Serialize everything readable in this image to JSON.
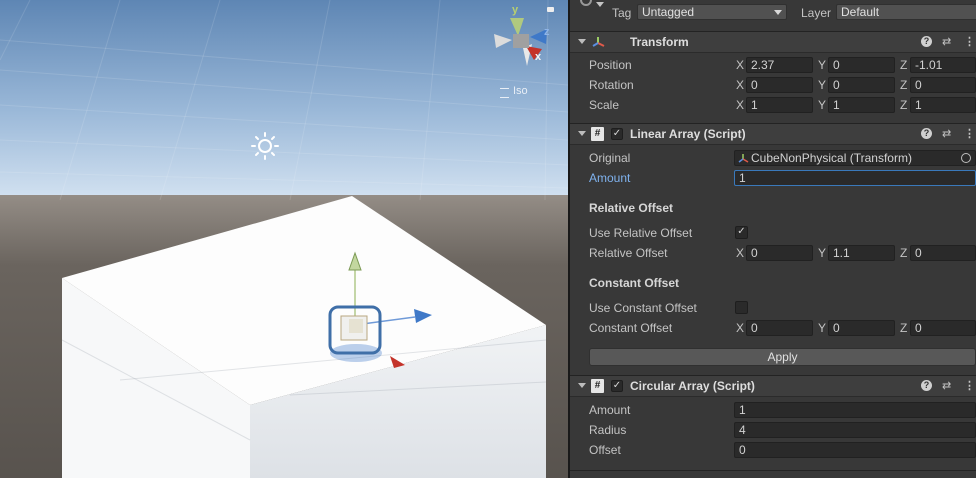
{
  "scene": {
    "iso_label": "Iso",
    "gizmo_axes": {
      "x": "x",
      "y": "y",
      "z": "z"
    },
    "colors": {
      "sky_top": "#5e86b4",
      "sky_horizon": "#d3e2f1",
      "ground": "#5d5853",
      "x_axis": "#c4332a",
      "y_axis": "#b1c88a",
      "z_axis": "#3f79c8"
    }
  },
  "inspector": {
    "tag_label": "Tag",
    "tag_value": "Untagged",
    "layer_label": "Layer",
    "layer_value": "Default",
    "transform": {
      "title": "Transform",
      "position": {
        "label": "Position",
        "x": "2.37",
        "y": "0",
        "z": "-1.01"
      },
      "rotation": {
        "label": "Rotation",
        "x": "0",
        "y": "0",
        "z": "0"
      },
      "scale": {
        "label": "Scale",
        "x": "1",
        "y": "1",
        "z": "1"
      }
    },
    "axis_labels": {
      "x": "X",
      "y": "Y",
      "z": "Z"
    },
    "linear_array": {
      "title": "Linear Array (Script)",
      "original_label": "Original",
      "original_value": "CubeNonPhysical (Transform)",
      "amount_label": "Amount",
      "amount_value": "1",
      "relative_offset_header": "Relative Offset",
      "use_relative_offset_label": "Use Relative Offset",
      "use_relative_offset_checked": "✓",
      "relative_offset_label": "Relative Offset",
      "relative_offset": {
        "x": "0",
        "y": "1.1",
        "z": "0"
      },
      "constant_offset_header": "Constant Offset",
      "use_constant_offset_label": "Use Constant Offset",
      "constant_offset_label": "Constant Offset",
      "constant_offset": {
        "x": "0",
        "y": "0",
        "z": "0"
      },
      "apply_label": "Apply"
    },
    "circular_array": {
      "title": "Circular Array (Script)",
      "amount_label": "Amount",
      "amount_value": "1",
      "radius_label": "Radius",
      "radius_value": "4",
      "offset_label": "Offset",
      "offset_value": "0"
    }
  }
}
